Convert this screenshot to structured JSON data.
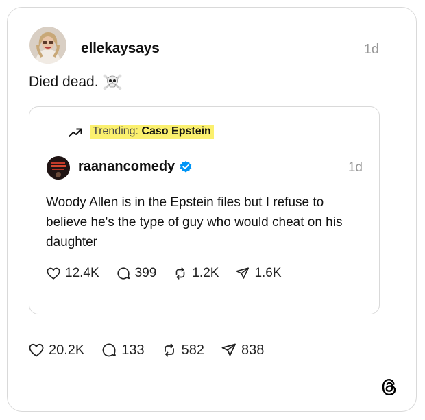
{
  "post": {
    "username": "ellekaysays",
    "time": "1d",
    "text": "Died dead.",
    "emoji_icon": "skull-crossbones-icon",
    "stats": {
      "likes": "20.2K",
      "replies": "133",
      "reposts": "582",
      "shares": "838"
    }
  },
  "quoted": {
    "trending_prefix": "Trending:",
    "trending_topic": "Caso Epstein",
    "username": "raanancomedy",
    "verified": true,
    "time": "1d",
    "text": "Woody Allen is in the Epstein files but I refuse to believe he's the type of guy who would cheat on his daughter",
    "stats": {
      "likes": "12.4K",
      "replies": "399",
      "reposts": "1.2K",
      "shares": "1.6K"
    }
  },
  "colors": {
    "highlight": "#fbf06e",
    "verified_blue": "#0095f6",
    "muted": "#999999",
    "border": "#d9d9d9"
  },
  "footer": {
    "logo_icon": "threads-logo-icon"
  }
}
